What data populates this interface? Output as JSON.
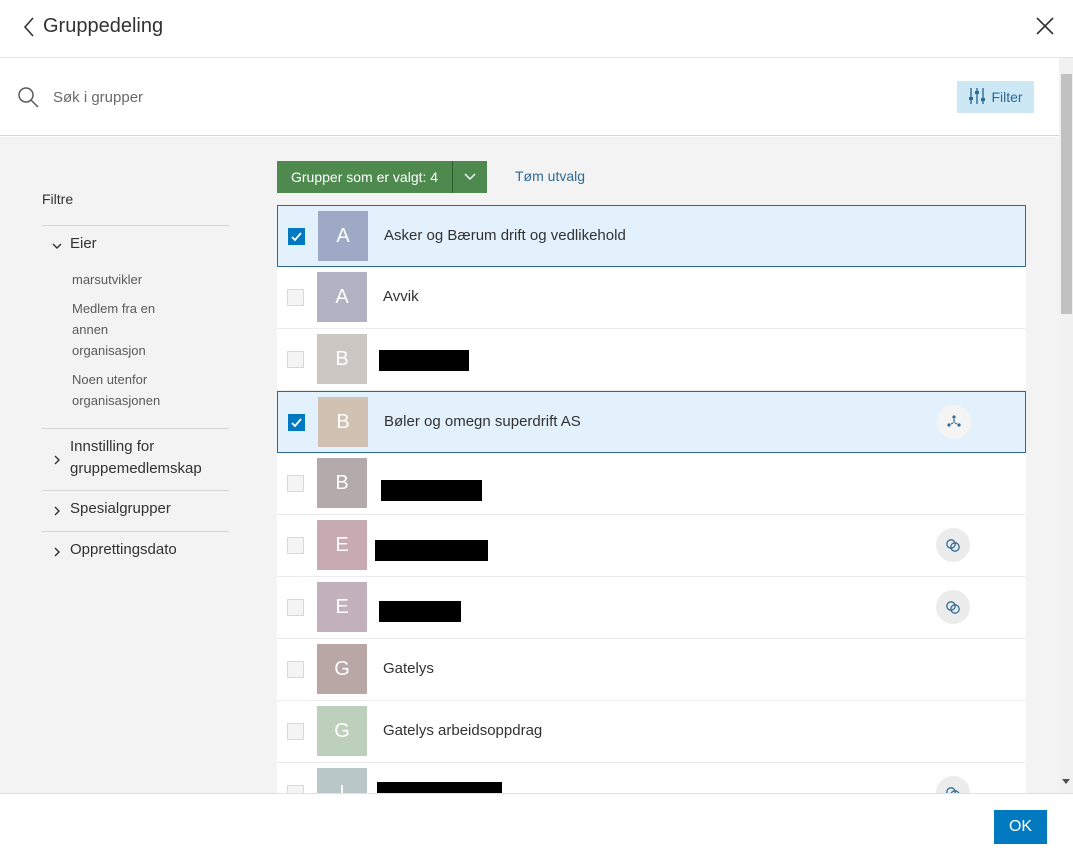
{
  "header": {
    "title": "Gruppedeling"
  },
  "search": {
    "placeholder": "Søk i grupper",
    "value": ""
  },
  "filter_button": {
    "label": "Filter"
  },
  "sidebar": {
    "title": "Filtre",
    "sections": [
      {
        "label": "Eier",
        "expanded": true,
        "items": [
          "marsutvikler",
          "Medlem fra en annen organisasjon",
          "Noen utenfor organisasjonen"
        ]
      },
      {
        "label": "Innstilling for gruppemedlemskap",
        "expanded": false
      },
      {
        "label": "Spesialgrupper",
        "expanded": false
      },
      {
        "label": "Opprettingsdato",
        "expanded": false
      }
    ]
  },
  "selection": {
    "button_label": "Grupper som er valgt: 4",
    "clear_label": "Tøm utvalg"
  },
  "groups": [
    {
      "initial": "A",
      "name": "Asker og Bærum drift og vedlikehold",
      "checked": true,
      "color": "#9ea9c5",
      "icon": null
    },
    {
      "initial": "A",
      "name": "Avvik",
      "checked": false,
      "color": "#b1b3c5",
      "icon": null
    },
    {
      "initial": "B",
      "name": "",
      "checked": false,
      "color": "#cbc6c2",
      "icon": null
    },
    {
      "initial": "B",
      "name": "Bøler og omegn superdrift AS",
      "checked": true,
      "color": "#d1c1b2",
      "icon": "partnered-collab-icon"
    },
    {
      "initial": "B",
      "name": "",
      "checked": false,
      "color": "#b4a9ab",
      "icon": null
    },
    {
      "initial": "E",
      "name": "",
      "checked": false,
      "color": "#c8aab3",
      "icon": "shared-update-icon"
    },
    {
      "initial": "E",
      "name": "",
      "checked": false,
      "color": "#c2b1bd",
      "icon": "shared-update-icon"
    },
    {
      "initial": "G",
      "name": "Gatelys",
      "checked": false,
      "color": "#b8a7a5",
      "icon": null
    },
    {
      "initial": "G",
      "name": "Gatelys arbeidsoppdrag",
      "checked": false,
      "color": "#bcd0bb",
      "icon": null
    },
    {
      "initial": "I",
      "name": "",
      "checked": false,
      "color": "#b9c7c9",
      "icon": "shared-update-icon"
    }
  ],
  "footer": {
    "ok_label": "OK"
  },
  "colors": {
    "accent": "#0079c1",
    "selection_button": "#4e8a4e",
    "filter_bg": "#cde8f5",
    "link": "#2e6a96"
  }
}
